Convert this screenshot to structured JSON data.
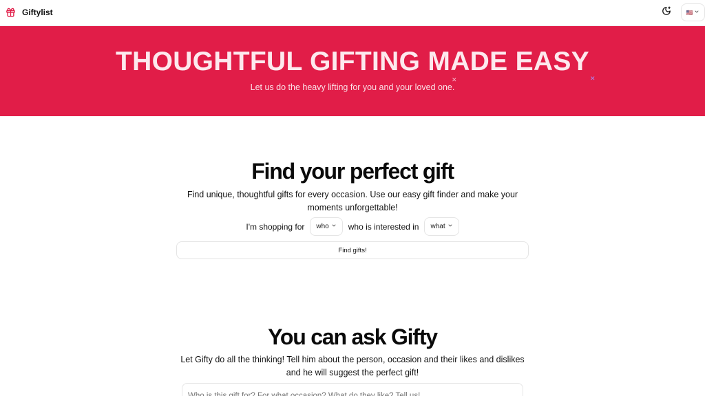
{
  "navbar": {
    "brand_name": "Giftylist",
    "brand_icon": "gift-icon",
    "theme_icon": "moon-icon",
    "language_label": "🇺🇸",
    "language_chevron": "chevron-down-icon"
  },
  "hero": {
    "title": "THOUGHTFUL GIFTING MADE EASY",
    "subtitle": "Let us do the heavy lifting for you and your loved one.",
    "background_color": "#e11d48"
  },
  "finder": {
    "title": "Find your perfect gift",
    "description": "Find unique, thoughtful gifts for every occasion. Use our easy gift finder and make your moments unforgettable!",
    "shopping_for_label": "I'm shopping for",
    "who_value": "who",
    "interested_label": "who is interested in",
    "what_value": "what",
    "submit_label": "Find gifts!"
  },
  "ask": {
    "title": "You can ask Gifty",
    "description": "Let Gifty do all the thinking! Tell him about the person, occasion and their likes and dislikes and he will suggest the perfect gift!",
    "input_placeholder": "Who is this gift for? For what occasion? What do they like? Tell us!"
  }
}
